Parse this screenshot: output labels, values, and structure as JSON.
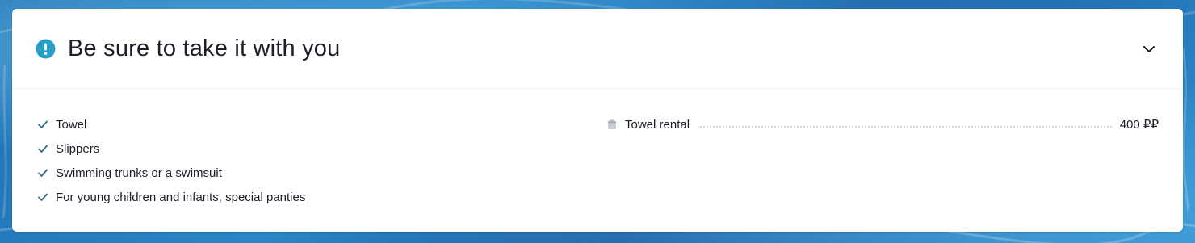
{
  "section": {
    "title": "Be sure to take it with you",
    "alert_icon": "exclamation-circle-icon",
    "toggle_icon": "chevron-down-icon",
    "accent_color": "#2a9fc6"
  },
  "checklist": {
    "icon": "check-icon",
    "items": [
      "Towel",
      "Slippers",
      "Swimming trunks or a swimsuit",
      "For young children and infants, special panties"
    ]
  },
  "rental": {
    "icon": "towel-icon",
    "name": "Towel rental",
    "price": "400 ₽₽"
  }
}
